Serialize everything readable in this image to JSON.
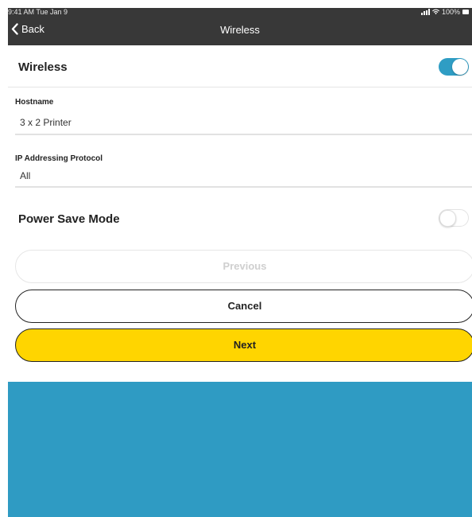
{
  "status_bar": {
    "time": "9:41 AM  Tue Jan 9",
    "battery": "100%",
    "icons": [
      "signal-icon",
      "wifi-icon",
      "battery-icon"
    ]
  },
  "nav": {
    "back_label": "Back",
    "back_icon": "chevron-left-icon",
    "title": "Wireless"
  },
  "wireless": {
    "label": "Wireless",
    "enabled": true
  },
  "hostname": {
    "label": "Hostname",
    "value": "3 x 2 Printer"
  },
  "ip_protocol": {
    "label": "IP Addressing Protocol",
    "value": "All"
  },
  "power_save": {
    "label": "Power Save Mode",
    "enabled": false
  },
  "buttons": {
    "previous": "Previous",
    "cancel": "Cancel",
    "next": "Next"
  },
  "colors": {
    "nav_bar": "#383838",
    "accent_blue": "#2f9dc4",
    "next_button": "#ffd500",
    "bottom_panel": "#2f9bc3"
  }
}
